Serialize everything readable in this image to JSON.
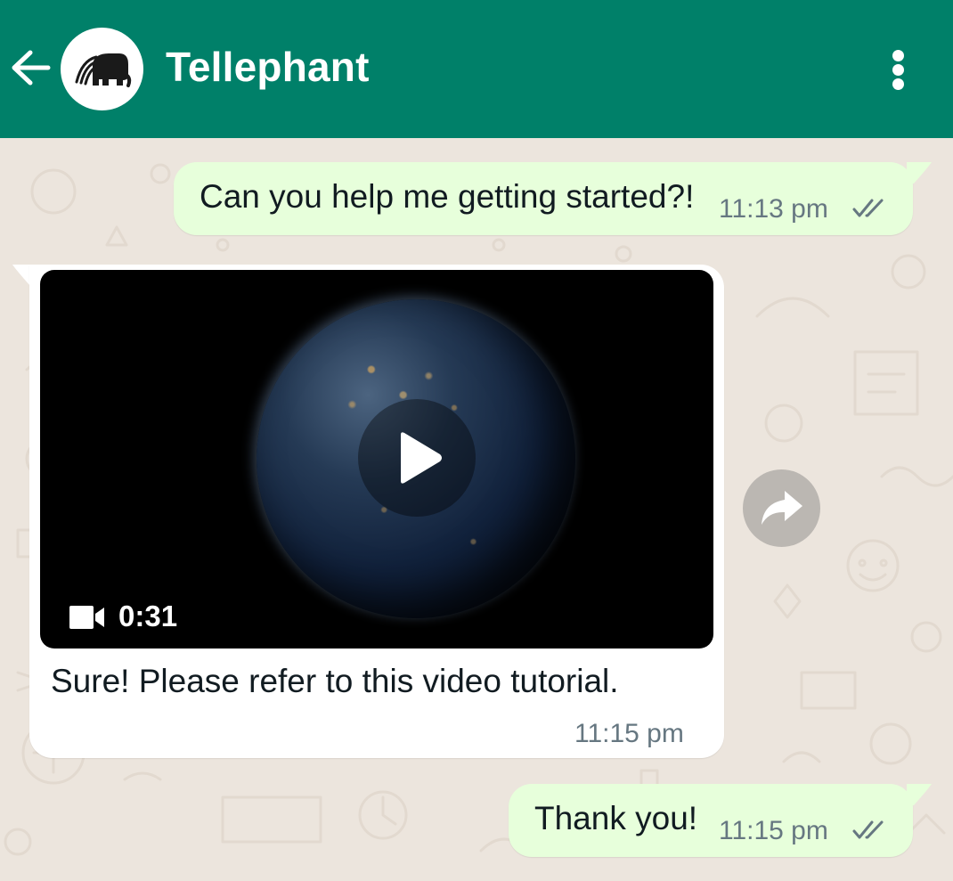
{
  "header": {
    "title": "Tellephant",
    "background_color": "#008069",
    "icons": {
      "back": "arrow-left-icon",
      "avatar": "elephant-logo",
      "menu": "more-vertical-icon"
    }
  },
  "messages": [
    {
      "direction": "outgoing",
      "text": "Can you help me getting started?!",
      "time": "11:13 pm",
      "status": "read",
      "bubble_color": "#e7ffdb"
    },
    {
      "direction": "incoming",
      "type": "video",
      "video": {
        "duration": "0:31",
        "icon": "video-camera-icon"
      },
      "caption": "Sure! Please refer to this video tutorial.",
      "time": "11:15 pm",
      "bubble_color": "#ffffff"
    },
    {
      "direction": "outgoing",
      "text": "Thank you!",
      "time": "11:15 pm",
      "status": "read",
      "bubble_color": "#e7ffdb"
    }
  ],
  "chat": {
    "wallpaper_color": "#ece5dd",
    "forward_icon": "forward-arrow-icon",
    "read_receipt_icon": "double-check-icon"
  }
}
